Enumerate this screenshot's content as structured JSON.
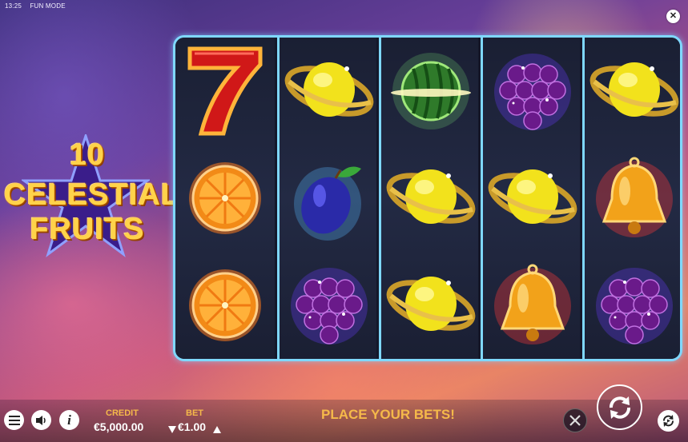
{
  "status": {
    "time": "13:25",
    "mode": "FUN MODE"
  },
  "logo": {
    "line1": "10",
    "line2": "CELESTIAL",
    "line3": "FRUITS"
  },
  "reels": [
    [
      "seven",
      "orange",
      "orange"
    ],
    [
      "saturn-lemon",
      "plum",
      "grapes"
    ],
    [
      "watermelon",
      "saturn-lemon",
      "saturn-lemon"
    ],
    [
      "grapes",
      "saturn-lemon",
      "bell"
    ],
    [
      "saturn-lemon",
      "bell",
      "grapes"
    ]
  ],
  "footer": {
    "credit_label": "CREDIT",
    "credit_value": "€5,000.00",
    "bet_label": "BET",
    "bet_value": "€1.00",
    "message": "PLACE YOUR BETS!"
  },
  "icons": {
    "menu": "menu-icon",
    "sound": "sound-icon",
    "info": "info-icon",
    "turbo": "turbo-off-icon",
    "spin": "spin-icon",
    "autoplay": "autoplay-icon",
    "close": "close-icon"
  },
  "colors": {
    "reel_border": "#7fd8ff",
    "accent": "#f5b94a"
  }
}
